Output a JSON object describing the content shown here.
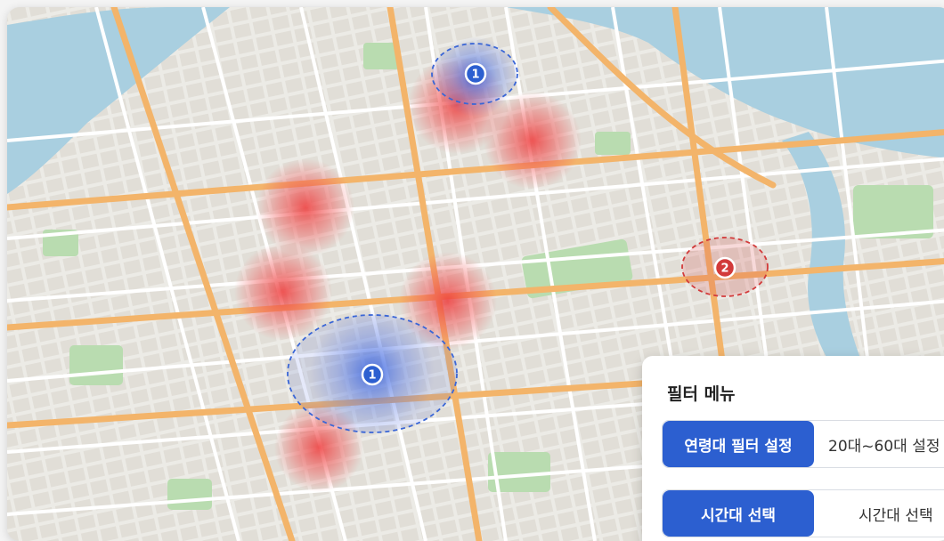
{
  "filter_panel": {
    "title": "필터 메뉴",
    "age_filter_button": "연령대 필터 설정",
    "age_filter_value": "20대~60대 설정",
    "time_filter_button": "시간대 선택",
    "time_filter_value": "시간대 선택"
  },
  "clusters": [
    {
      "label": "1",
      "color": "#2c5fd0"
    },
    {
      "label": "1",
      "color": "#2c5fd0"
    },
    {
      "label": "2",
      "color": "#d23a3a"
    }
  ],
  "colors": {
    "water": "#a9cfe0",
    "park": "#b9dcb0",
    "major_road": "#f3b46a",
    "hotspot_red": "#ee3a3a",
    "hotspot_blue": "#2f5fe0"
  }
}
